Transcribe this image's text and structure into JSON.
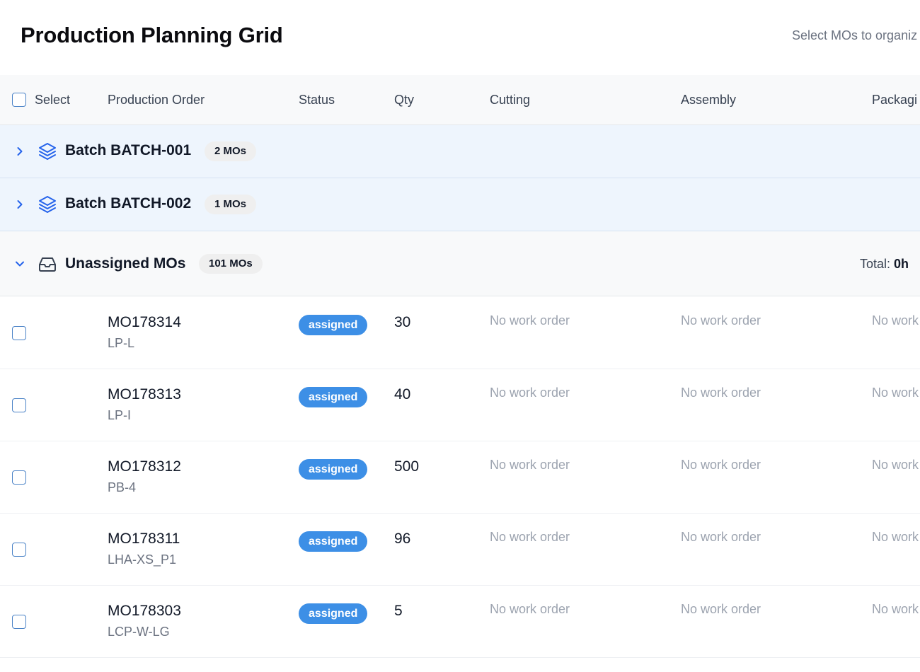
{
  "header": {
    "title": "Production Planning Grid",
    "hint": "Select MOs to organiz"
  },
  "table": {
    "columns": {
      "select": "Select",
      "order": "Production Order",
      "status": "Status",
      "qty": "Qty",
      "cutting": "Cutting",
      "assembly": "Assembly",
      "packaging": "Packagi"
    }
  },
  "groups": {
    "batch1": {
      "name": "Batch BATCH-001",
      "count": "2 MOs",
      "expanded": false
    },
    "batch2": {
      "name": "Batch BATCH-002",
      "count": "1 MOs",
      "expanded": false
    },
    "unassigned": {
      "name": "Unassigned MOs",
      "count": "101 MOs",
      "total_label": "Total:",
      "total_value": "0h",
      "expanded": true
    }
  },
  "rows": [
    {
      "number": "MO178314",
      "product": "LP-L",
      "status": "assigned",
      "qty": "30",
      "cutting": "No work order",
      "assembly": "No work order",
      "packaging": "No work"
    },
    {
      "number": "MO178313",
      "product": "LP-I",
      "status": "assigned",
      "qty": "40",
      "cutting": "No work order",
      "assembly": "No work order",
      "packaging": "No work"
    },
    {
      "number": "MO178312",
      "product": "PB-4",
      "status": "assigned",
      "qty": "500",
      "cutting": "No work order",
      "assembly": "No work order",
      "packaging": "No work"
    },
    {
      "number": "MO178311",
      "product": "LHA-XS_P1",
      "status": "assigned",
      "qty": "96",
      "cutting": "No work order",
      "assembly": "No work order",
      "packaging": "No work"
    },
    {
      "number": "MO178303",
      "product": "LCP-W-LG",
      "status": "assigned",
      "qty": "5",
      "cutting": "No work order",
      "assembly": "No work order",
      "packaging": "No work"
    }
  ],
  "icons": {
    "expand": "chevron-right-icon",
    "collapse": "chevron-down-icon",
    "batch": "layers-icon",
    "unassigned": "inbox-icon"
  },
  "colors": {
    "accent": "#2563eb",
    "status_assigned": "#3d8fe6",
    "batch_row_bg": "#eef5fd",
    "muted_text": "#9ca3af"
  }
}
